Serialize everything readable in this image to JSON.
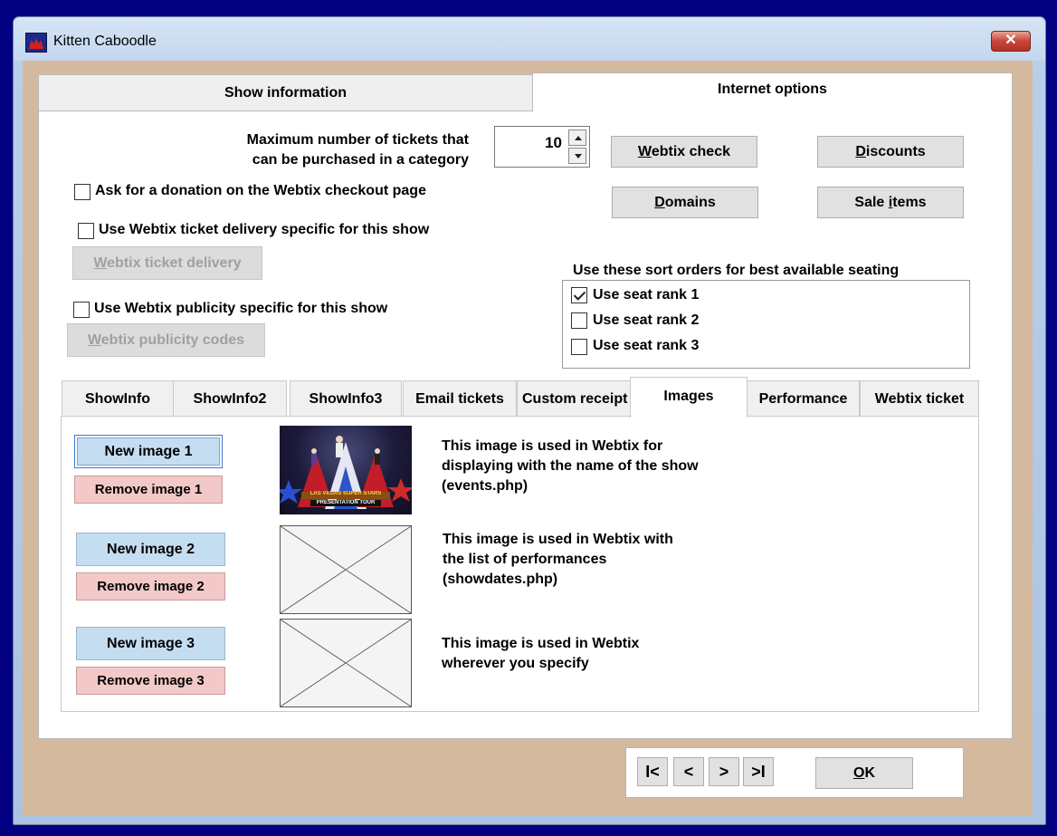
{
  "window": {
    "title": "Kitten Caboodle",
    "close_glyph": "✕"
  },
  "main_tabs": [
    {
      "label": "Show information"
    },
    {
      "label": "Internet options"
    }
  ],
  "max_tickets": {
    "label_line1": "Maximum number of tickets that",
    "label_line2": "can be purchased in a category",
    "value": "10"
  },
  "buttons": {
    "webtix_check": {
      "accel": "W",
      "rest": "ebtix check"
    },
    "discounts": {
      "accel": "D",
      "rest": "iscounts"
    },
    "domains": {
      "accel": "D",
      "rest": "omains"
    },
    "sale_items": {
      "pre": "Sale ",
      "accel": "i",
      "rest": "tems"
    },
    "webtix_ticket_delivery": {
      "accel": "W",
      "rest": "ebtix ticket delivery"
    },
    "webtix_publicity_codes": {
      "accel": "W",
      "rest": "ebtix publicity codes"
    }
  },
  "checkboxes": {
    "donation": {
      "label": "Ask for a donation on the Webtix checkout page",
      "checked": false
    },
    "ticket_delivery": {
      "label": "Use Webtix ticket delivery specific for this show",
      "checked": false
    },
    "publicity": {
      "label": "Use Webtix publicity specific for this show",
      "checked": false
    }
  },
  "sort_orders": {
    "title": "Use these sort orders for best available seating",
    "items": [
      {
        "label": "Use seat rank 1",
        "checked": true
      },
      {
        "label": "Use seat rank 2",
        "checked": false
      },
      {
        "label": "Use seat rank 3",
        "checked": false
      }
    ]
  },
  "inner_tabs": [
    {
      "label": "ShowInfo"
    },
    {
      "label": "ShowInfo2"
    },
    {
      "label": "ShowInfo3"
    },
    {
      "label": "Email tickets"
    },
    {
      "label": "Custom receipt"
    },
    {
      "label": "Images"
    },
    {
      "label": "Performance"
    },
    {
      "label": "Webtix ticket"
    }
  ],
  "images": [
    {
      "new_label": "New image 1",
      "remove_label": "Remove image 1",
      "desc_lines": [
        "This image is used in Webtix for",
        "displaying with the name of the show",
        "(events.php)"
      ],
      "has_image": true
    },
    {
      "new_label": "New image 2",
      "remove_label": "Remove image 2",
      "desc_lines": [
        "This image is used in Webtix with",
        "the list of performances",
        "(showdates.php)"
      ],
      "has_image": false
    },
    {
      "new_label": "New image 3",
      "remove_label": "Remove image 3",
      "desc_lines": [
        "This image is used in Webtix",
        "wherever you specify"
      ],
      "has_image": false
    }
  ],
  "show_image_text": {
    "line1": "LAS VEGAS SUPER STARS",
    "line2": "PRESENTATION TOUR"
  },
  "nav": {
    "first": "I<",
    "prev": "<",
    "next": ">",
    "last": ">I",
    "ok_accel": "O",
    "ok_rest": "K"
  }
}
